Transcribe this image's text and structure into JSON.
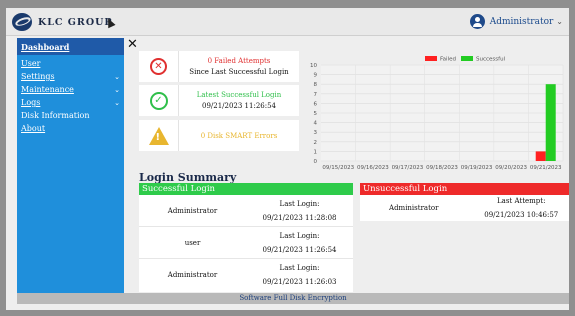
{
  "header": {
    "brand": "KLC GROUP",
    "user_label": "Administrator"
  },
  "sidebar": {
    "items": [
      {
        "label": "Dashboard"
      },
      {
        "label": "User"
      },
      {
        "label": "Settings"
      },
      {
        "label": "Maintenance"
      },
      {
        "label": "Logs"
      },
      {
        "label": "Disk Information"
      },
      {
        "label": "About"
      }
    ]
  },
  "stats": {
    "failed": {
      "title": "0 Failed Attempts",
      "subtitle": "Since Last Successful Login",
      "color": "#e03030",
      "icon": "x-circle-icon"
    },
    "latest": {
      "title": "Latest Successful Login",
      "subtitle": "09/21/2023 11:26:54",
      "color": "#2fbf4a",
      "icon": "check-circle-icon"
    },
    "smart": {
      "title": "0 Disk SMART Errors",
      "color": "#e8b62f",
      "icon": "warning-icon"
    }
  },
  "summary": {
    "title": "Login Summary",
    "successful": {
      "header": "Successful Login",
      "rows": [
        {
          "user": "Administrator",
          "label": "Last Login:",
          "time": "09/21/2023 11:28:08"
        },
        {
          "user": "user",
          "label": "Last Login:",
          "time": "09/21/2023 11:26:54"
        },
        {
          "user": "Administrator",
          "label": "Last Login:",
          "time": "09/21/2023 11:26:03"
        }
      ]
    },
    "unsuccessful": {
      "header": "Unsuccessful Login",
      "rows": [
        {
          "user": "Administrator",
          "label": "Last Attempt:",
          "time": "09/21/2023 10:46:57"
        }
      ]
    }
  },
  "footer": {
    "text": "Software Full Disk Encryption"
  },
  "chart_data": {
    "type": "bar",
    "categories": [
      "09/15/2023",
      "09/16/2023",
      "09/17/2023",
      "09/18/2023",
      "09/19/2023",
      "09/20/2023",
      "09/21/2023"
    ],
    "series": [
      {
        "name": "Failed",
        "color": "#ff2020",
        "values": [
          0,
          0,
          0,
          0,
          0,
          0,
          1
        ]
      },
      {
        "name": "Successful",
        "color": "#22cc22",
        "values": [
          0,
          0,
          0,
          0,
          0,
          0,
          8
        ]
      }
    ],
    "ylim": [
      0,
      10
    ],
    "yticks": [
      0,
      1,
      2,
      3,
      4,
      5,
      6,
      7,
      8,
      9,
      10
    ],
    "legend": "top-center",
    "grid": true
  }
}
